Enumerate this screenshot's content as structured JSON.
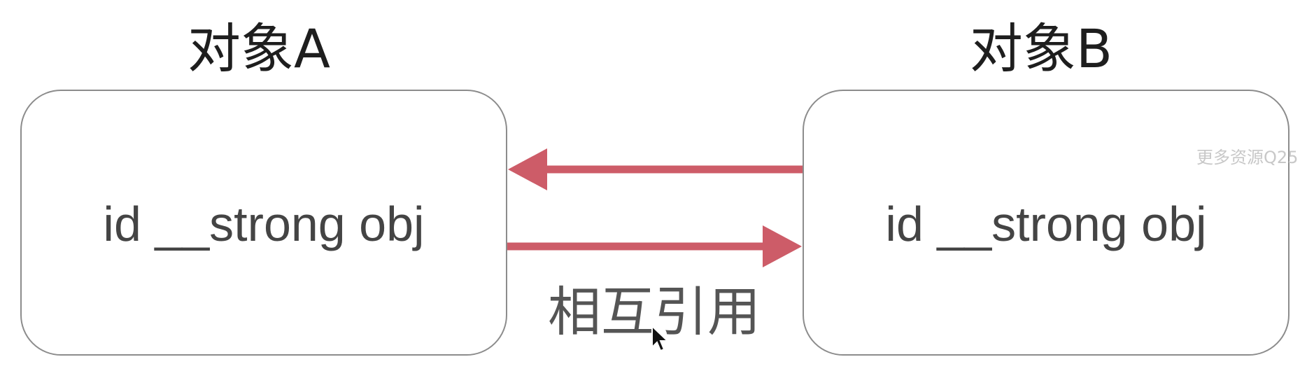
{
  "objects": [
    {
      "title": "对象A",
      "content": "id __strong obj"
    },
    {
      "title": "对象B",
      "content": "id __strong obj"
    }
  ],
  "relation_label": "相互引用",
  "watermark": "更多资源Q25",
  "colors": {
    "arrow": "#cd5c68",
    "box_border": "#8c8c8c",
    "title_text": "#1e1e1e",
    "content_text": "#444444",
    "label_text": "#555555"
  },
  "icons": {
    "cursor": "mouse-pointer-icon"
  }
}
